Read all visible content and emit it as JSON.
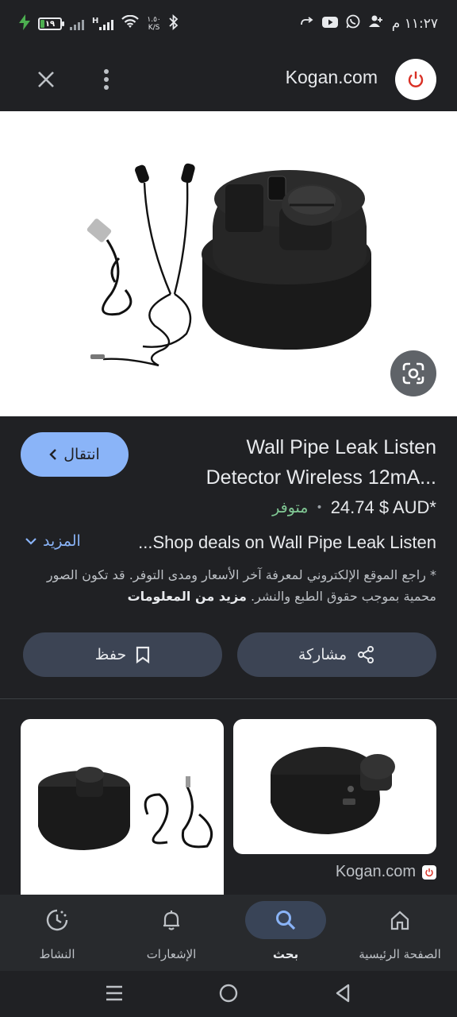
{
  "status_bar": {
    "battery_level": "١٩",
    "battery_fraction": 0.19,
    "network_type": "H",
    "speed_value": "١.٥٠",
    "speed_unit": "K/S",
    "time": "١١:٢٧ م"
  },
  "app_bar": {
    "site_title": "Kogan.com"
  },
  "product": {
    "title_line1": "Wall Pipe Leak Listen",
    "title_line2": "...Detector Wireless 12mA",
    "visit_label": "انتقال",
    "price": "24.74 $ AUD*",
    "availability": "متوفر",
    "deals_text": "...Shop deals on Wall Pipe Leak Listen",
    "more_label": "المزيد",
    "disclaimer": "* راجع الموقع الإلكتروني لمعرفة آخر الأسعار ومدى التوفر. قد تكون الصور محمية بموجب حقوق الطبع والنشر.",
    "disclaimer_link": "مزيد من المعلومات",
    "share_label": "مشاركة",
    "save_label": "حفظ"
  },
  "related": {
    "source": "Kogan.com"
  },
  "bottom_nav": {
    "items": [
      {
        "label": "الصفحة الرئيسية",
        "icon": "home-icon"
      },
      {
        "label": "بحث",
        "icon": "search-icon"
      },
      {
        "label": "الإشعارات",
        "icon": "bell-icon"
      },
      {
        "label": "النشاط",
        "icon": "activity-icon"
      }
    ],
    "active_index": 1
  },
  "colors": {
    "background": "#202124",
    "accent": "#8ab4f8",
    "in_stock": "#81c995",
    "action_button": "#3c4454",
    "brand_red": "#d93025"
  }
}
